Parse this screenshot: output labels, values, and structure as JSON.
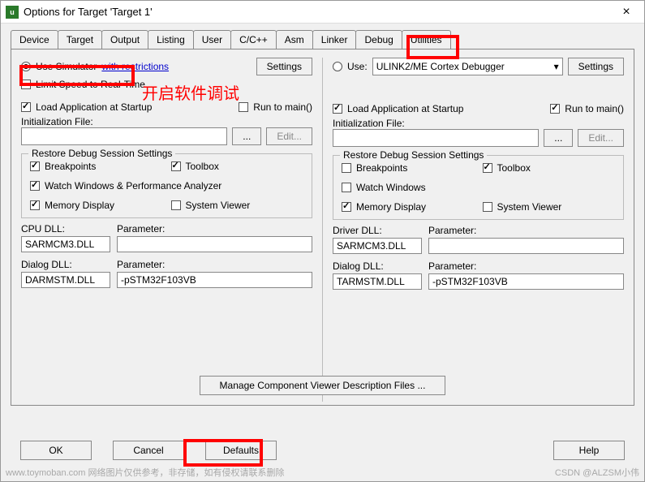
{
  "window": {
    "title": "Options for Target 'Target 1'",
    "close_icon": "×"
  },
  "tabs": [
    "Device",
    "Target",
    "Output",
    "Listing",
    "User",
    "C/C++",
    "Asm",
    "Linker",
    "Debug",
    "Utilities"
  ],
  "active_tab": "Debug",
  "left": {
    "use_simulator": "Use Simulator",
    "with_restrictions": "with restrictions",
    "settings": "Settings",
    "limit_speed": "Limit Speed to Real-Time",
    "load_app": "Load Application at Startup",
    "run_main": "Run to main()",
    "init_file": "Initialization File:",
    "browse": "...",
    "edit": "Edit...",
    "restore_title": "Restore Debug Session Settings",
    "breakpoints": "Breakpoints",
    "toolbox": "Toolbox",
    "watch": "Watch Windows & Performance Analyzer",
    "memory": "Memory Display",
    "sysview": "System Viewer",
    "cpu_dll": "CPU DLL:",
    "parameter": "Parameter:",
    "cpu_dll_val": "SARMCM3.DLL",
    "cpu_param_val": "",
    "dialog_dll": "Dialog DLL:",
    "dialog_dll_val": "DARMSTM.DLL",
    "dialog_param_val": "-pSTM32F103VB"
  },
  "right": {
    "use": "Use:",
    "debugger": "ULINK2/ME Cortex Debugger",
    "settings": "Settings",
    "load_app": "Load Application at Startup",
    "run_main": "Run to main()",
    "init_file": "Initialization File:",
    "browse": "...",
    "edit": "Edit...",
    "restore_title": "Restore Debug Session Settings",
    "breakpoints": "Breakpoints",
    "toolbox": "Toolbox",
    "watch": "Watch Windows",
    "memory": "Memory Display",
    "sysview": "System Viewer",
    "driver_dll": "Driver DLL:",
    "parameter": "Parameter:",
    "driver_dll_val": "SARMCM3.DLL",
    "driver_param_val": "",
    "dialog_dll": "Dialog DLL:",
    "dialog_dll_val": "TARMSTM.DLL",
    "dialog_param_val": "-pSTM32F103VB"
  },
  "manage_btn": "Manage Component Viewer Description Files ...",
  "buttons": {
    "ok": "OK",
    "cancel": "Cancel",
    "defaults": "Defaults",
    "help": "Help"
  },
  "overlay": {
    "red_text": "开启软件调试"
  },
  "watermark_left": "www.toymoban.com 网络图片仅供参考，非存储，如有侵权请联系删除",
  "watermark_right": "CSDN @ALZSM小伟"
}
